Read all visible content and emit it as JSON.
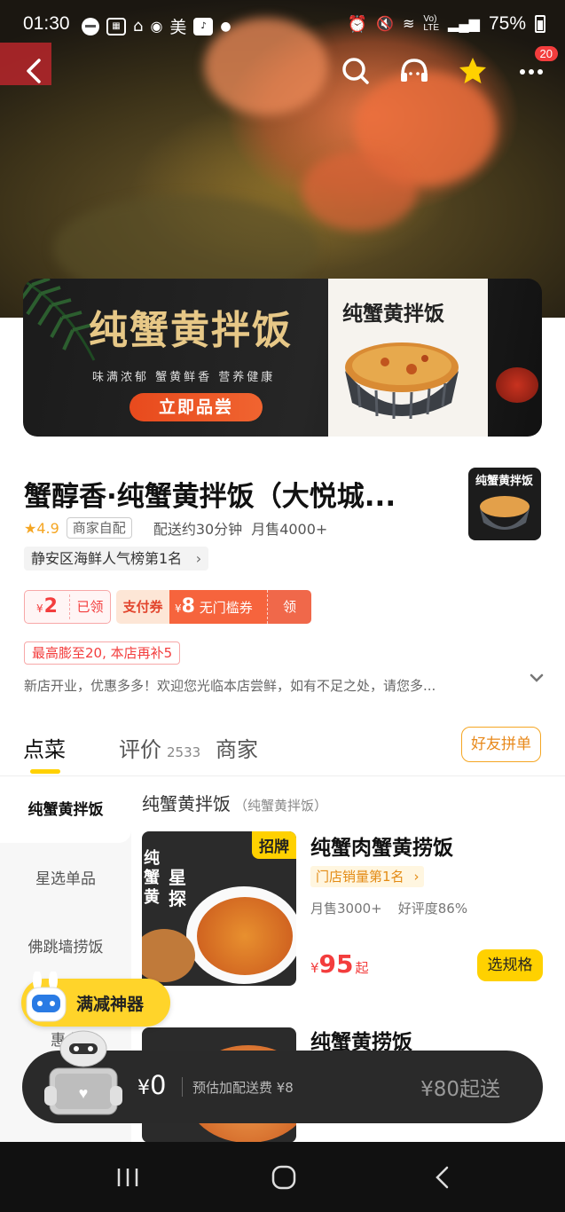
{
  "status_bar": {
    "time": "01:30",
    "notif_text": "美",
    "battery": "75%"
  },
  "hero": {
    "cart_badge": "20"
  },
  "banner": {
    "title": "纯蟹黄拌饭",
    "subtitle": "味满浓郁  蟹黄鲜香  营养健康",
    "cta": "立即品尝",
    "panel_title": "纯蟹黄拌饭"
  },
  "shop": {
    "name": "蟹醇香·纯蟹黄拌饭（大悦城...",
    "thumb_title": "纯蟹黄拌饭",
    "rating": "4.9",
    "delivery_tag": "商家自配",
    "delivery_time": "配送约30分钟",
    "monthly_sales": "月售4000+",
    "rank": "静安区海鲜人气榜第1名"
  },
  "coupons": {
    "a_symbol": "¥",
    "a_amount": "2",
    "a_status": "已领",
    "b_label": "支付券",
    "b_symbol": "¥",
    "b_amount": "8",
    "b_desc": "无门槛券",
    "b_claim": "领"
  },
  "promo_line": "最高膨至20, 本店再补5",
  "notice": "新店开业，优惠多多！欢迎您光临本店尝鲜，如有不足之处，请您多...",
  "tabs": [
    {
      "label": "点菜"
    },
    {
      "label": "评价",
      "count": "2533"
    },
    {
      "label": "商家"
    }
  ],
  "group_order": "好友拼单",
  "categories": [
    "纯蟹黄拌饭",
    "星选单品",
    "佛跳墙捞饭",
    "惠多"
  ],
  "section": {
    "title": "纯蟹黄拌饭",
    "subtitle": "（纯蟹黄拌饭）"
  },
  "products": [
    {
      "tag": "招牌",
      "name": "纯蟹肉蟹黄捞饭",
      "rank": "门店销量第1名",
      "sales": "月售3000+",
      "rating": "好评度86%",
      "price_symbol": "¥",
      "price": "95",
      "price_suffix": "起",
      "action": "选规格"
    },
    {
      "name": "纯蟹黄捞饭"
    }
  ],
  "float_promo": "满减神器",
  "cart": {
    "symbol": "¥",
    "amount": "0",
    "fee": "预估加配送费 ¥8",
    "minimum": "¥80起送"
  },
  "colors": {
    "accent_yellow": "#ffd100",
    "price_red": "#f33d3d",
    "cart_bg": "#2a2a2a"
  }
}
